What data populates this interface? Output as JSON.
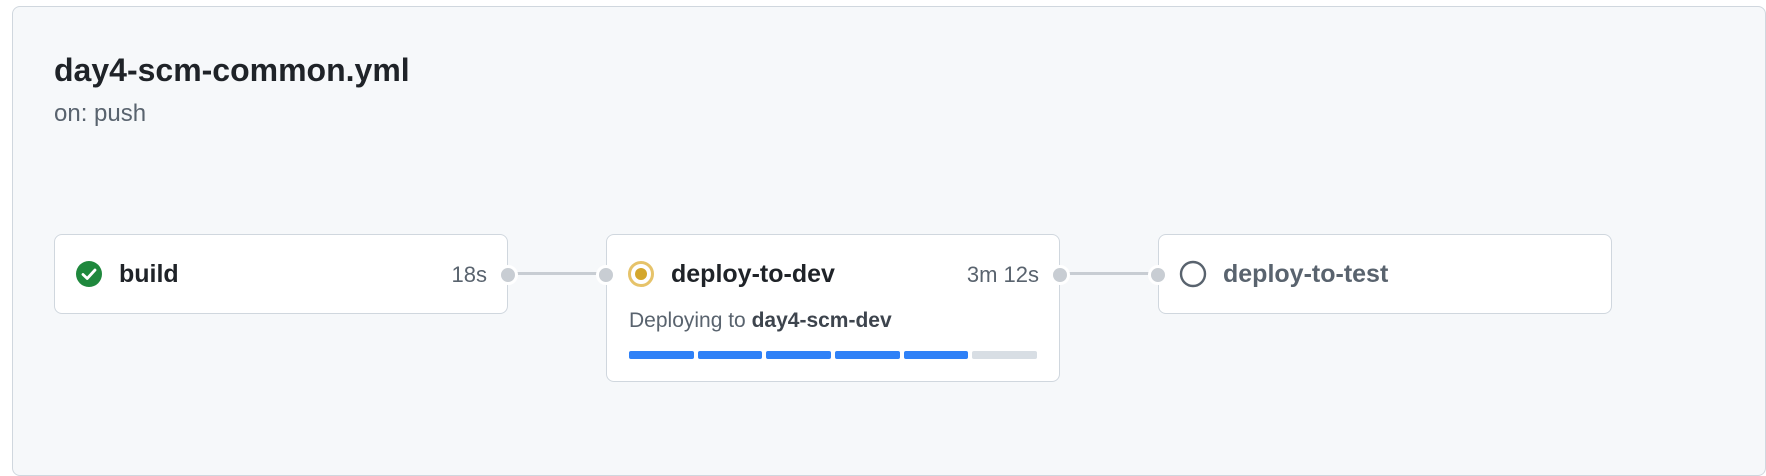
{
  "workflow": {
    "title": "day4-scm-common.yml",
    "trigger": "on: push"
  },
  "jobs": [
    {
      "name": "build",
      "status": "success",
      "status_icon": "check-circle-fill-icon",
      "duration": "18s"
    },
    {
      "name": "deploy-to-dev",
      "status": "in_progress",
      "status_icon": "in-progress-dot-icon",
      "duration": "3m 12s",
      "message_prefix": "Deploying to",
      "environment": "day4-scm-dev",
      "progress": {
        "completed_segments": 5,
        "total_segments": 6
      }
    },
    {
      "name": "deploy-to-test",
      "status": "pending",
      "status_icon": "circle-outline-icon",
      "duration": ""
    }
  ],
  "colors": {
    "success": "#1f883d",
    "in_progress": "#d4a72c",
    "pending": "#59636e",
    "progress_fill": "#2f81f7",
    "progress_track": "#d8dee4"
  }
}
